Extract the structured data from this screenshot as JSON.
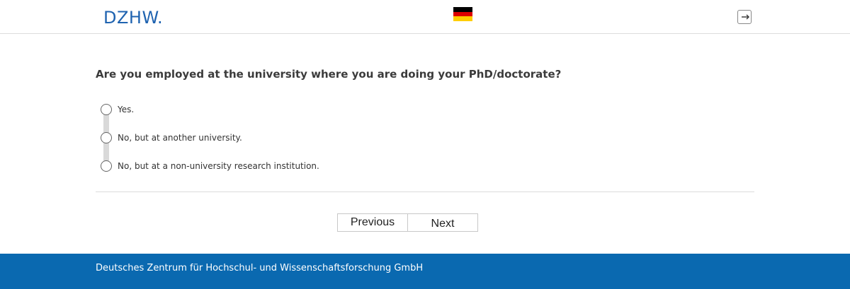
{
  "header": {
    "logo_text": "DZHW.",
    "language_flag": "germany-flag-icon",
    "flag_colors": [
      "#000000",
      "#dd0000",
      "#ffce00"
    ],
    "exit_icon": "logout-icon"
  },
  "question": {
    "text": "Are you employed at the university where you are doing your PhD/doctorate?",
    "options": [
      {
        "label": "Yes.",
        "selected": false
      },
      {
        "label": "No, but at another university.",
        "selected": false
      },
      {
        "label": "No, but at a non-university research institution.",
        "selected": false
      }
    ]
  },
  "navigation": {
    "previous_label": "Previous",
    "next_label": "Next"
  },
  "footer": {
    "text": "Deutsches Zentrum für Hochschul- und Wissenschaftsforschung GmbH"
  },
  "colors": {
    "brand_blue": "#0a69b0",
    "logo_blue": "#1f63b0"
  }
}
